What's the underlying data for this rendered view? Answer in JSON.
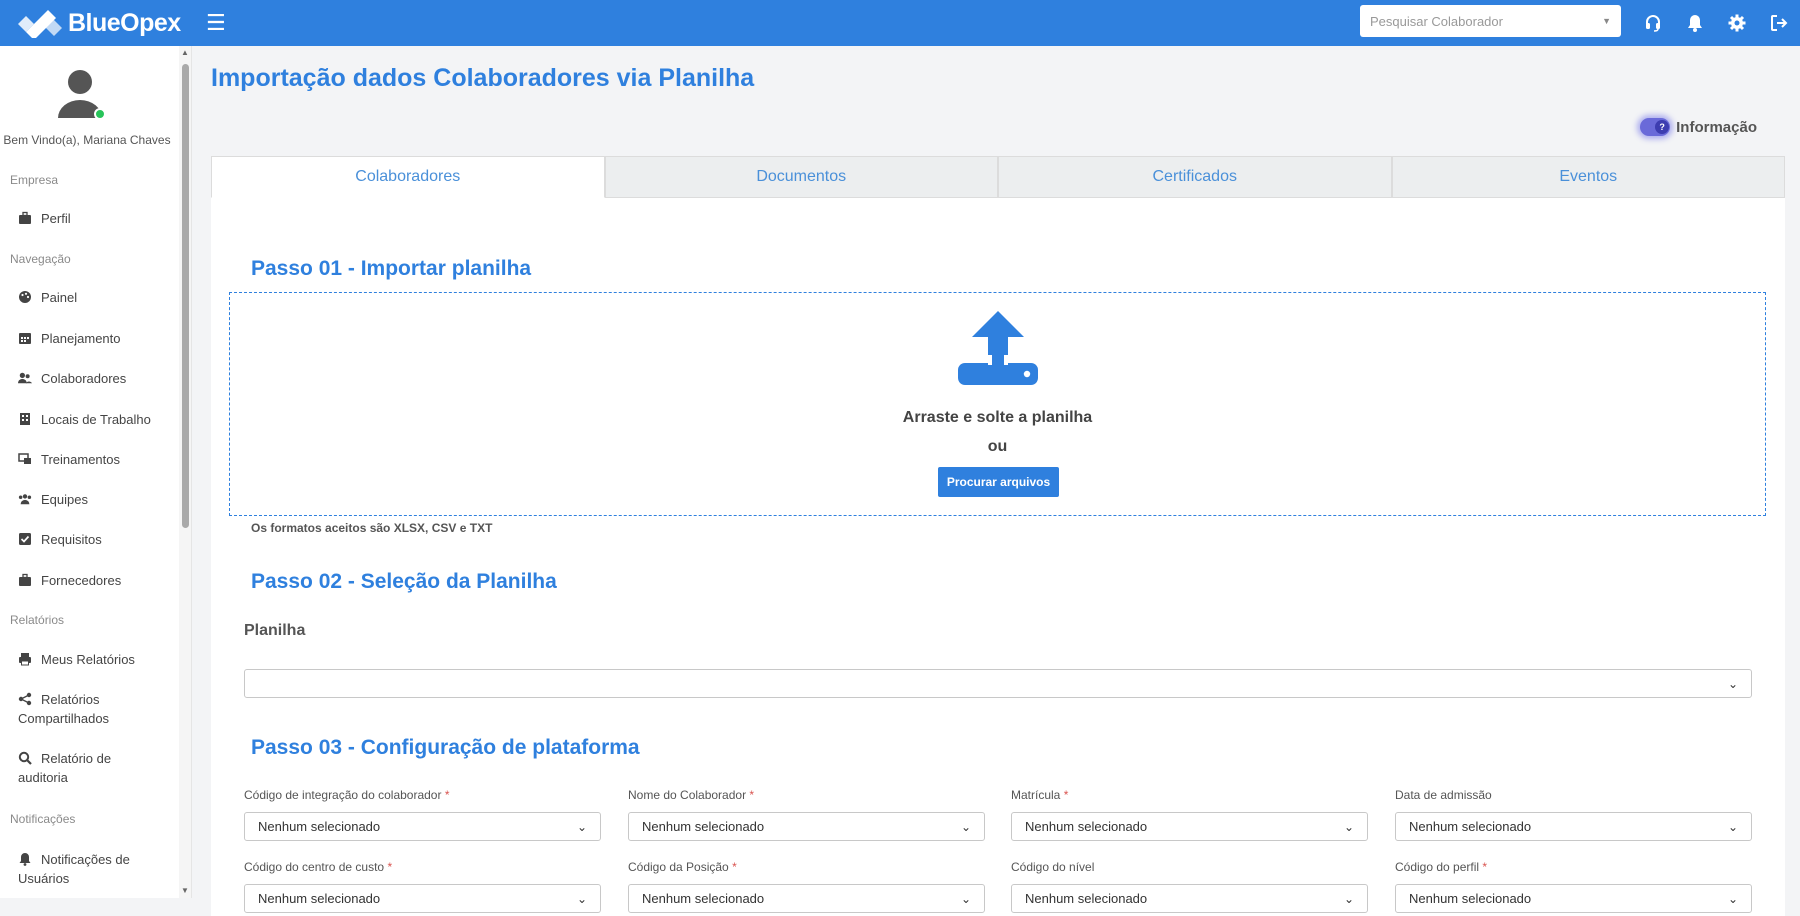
{
  "app": {
    "brand": "BlueOpex",
    "accent": "#2f80de"
  },
  "topbar": {
    "search_placeholder": "Pesquisar Colaborador",
    "icons": [
      "headset-icon",
      "bell-icon",
      "gear-icon",
      "logout-icon"
    ]
  },
  "sidebar": {
    "welcome": "Bem Vindo(a), Mariana Chaves",
    "sections": {
      "empresa": "Empresa",
      "navegacao": "Navegação",
      "relatorios": "Relatórios",
      "notificacoes": "Notificações"
    },
    "items": {
      "perfil": "Perfil",
      "painel": "Painel",
      "planejamento": "Planejamento",
      "colaboradores": "Colaboradores",
      "locais": "Locais de Trabalho",
      "treinamentos": "Treinamentos",
      "equipes": "Equipes",
      "requisitos": "Requisitos",
      "fornecedores": "Fornecedores",
      "meus_relatorios": "Meus Relatórios",
      "relatorios_comp_1": "Relatórios",
      "relatorios_comp_2": "Compartilhados",
      "auditoria_1": "Relatório de",
      "auditoria_2": "auditoria",
      "notif_1": "Notificações de",
      "notif_2": "Usuários"
    }
  },
  "main": {
    "title": "Importação dados Colaboradores via Planilha",
    "info_label": "Informação",
    "tabs": [
      "Colaboradores",
      "Documentos",
      "Certificados",
      "Eventos"
    ],
    "active_tab": "Colaboradores",
    "step1": {
      "title": "Passo 01 - Importar planilha",
      "drop_text": "Arraste e solte a planilha",
      "or_text": "ou",
      "button": "Procurar arquivos",
      "formats": "Os formatos aceitos são XLSX, CSV e TXT"
    },
    "step2": {
      "title": "Passo 02 - Seleção da Planilha",
      "label": "Planilha",
      "value": ""
    },
    "step3": {
      "title": "Passo 03 - Configuração de plataforma",
      "fields": [
        {
          "label": "Código de integração do colaborador",
          "required": "*",
          "value": "Nenhum selecionado"
        },
        {
          "label": "Nome do Colaborador",
          "required": "*",
          "value": "Nenhum selecionado"
        },
        {
          "label": "Matrícula",
          "required": "*",
          "value": "Nenhum selecionado"
        },
        {
          "label": "Data de admissão",
          "required": "",
          "value": "Nenhum selecionado"
        },
        {
          "label": "Código do centro de custo",
          "required": "*",
          "value": "Nenhum selecionado"
        },
        {
          "label": "Código da Posição",
          "required": "*",
          "value": "Nenhum selecionado"
        },
        {
          "label": "Código do nível",
          "required": "",
          "value": "Nenhum selecionado"
        },
        {
          "label": "Código do perfil",
          "required": "*",
          "value": "Nenhum selecionado"
        }
      ]
    }
  }
}
